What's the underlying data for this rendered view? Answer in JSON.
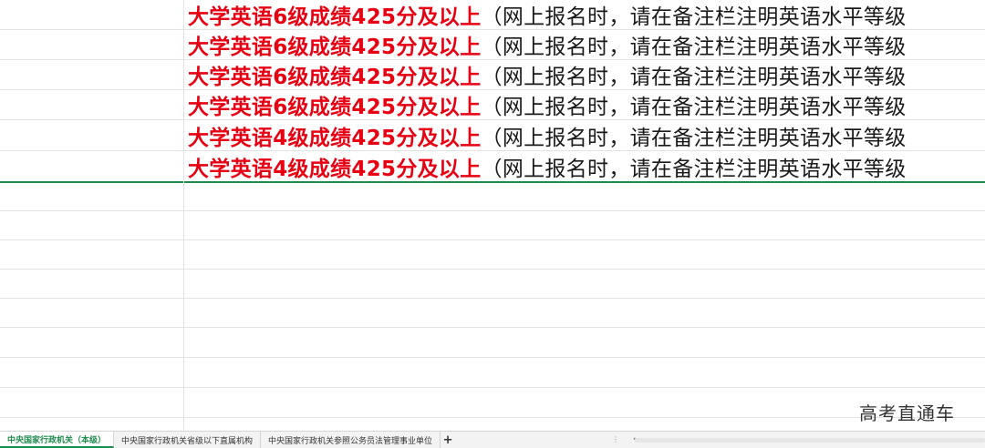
{
  "sheet": {
    "rows": [
      {
        "red": "大学英语6级成绩425分及以上",
        "rest": "（网上报名时，请在备注栏注明英语水平等级"
      },
      {
        "red": "大学英语6级成绩425分及以上",
        "rest": "（网上报名时，请在备注栏注明英语水平等级"
      },
      {
        "red": "大学英语6级成绩425分及以上",
        "rest": "（网上报名时，请在备注栏注明英语水平等级"
      },
      {
        "red": "大学英语6级成绩425分及以上",
        "rest": "（网上报名时，请在备注栏注明英语水平等级"
      },
      {
        "red": "大学英语4级成绩425分及以上",
        "rest": "（网上报名时，请在备注栏注明英语水平等级"
      },
      {
        "red": "大学英语4级成绩425分及以上",
        "rest": "（网上报名时，请在备注栏注明英语水平等级"
      }
    ],
    "red_color": "#e60012",
    "selection_color": "#1e8a4c"
  },
  "watermark": "高考直通车",
  "tabs": [
    {
      "label": "中央国家行政机关（本级）",
      "active": true
    },
    {
      "label": "中央国家行政机关省级以下直属机构",
      "active": false
    },
    {
      "label": "中央国家行政机关参照公务员法管理事业单位",
      "active": false
    }
  ],
  "add_sheet_label": "+"
}
